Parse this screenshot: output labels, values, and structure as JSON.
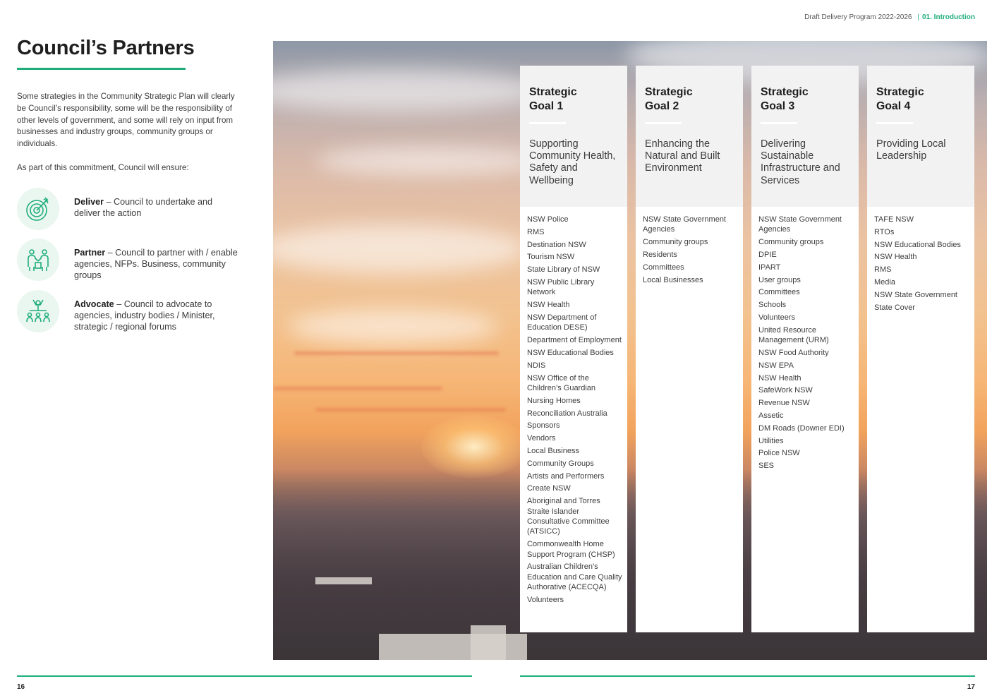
{
  "header": {
    "document": "Draft Delivery Program 2022-2026",
    "separator": "|",
    "section": "01. Introduction"
  },
  "title": "Council’s Partners",
  "intro": {
    "paragraph1": "Some strategies in the Community Strategic Plan will clearly be Council’s responsibility, some will be the responsibility of other levels of government, and some will rely on input from businesses and industry groups, community groups or individuals.",
    "paragraph2": "As part of this commitment, Council will ensure:"
  },
  "legend": [
    {
      "icon": "target-icon",
      "term": "Deliver",
      "description": " – Council to undertake and deliver the action"
    },
    {
      "icon": "partner-people-icon",
      "term": "Partner",
      "description": " – Council to partner with / enable agencies, NFPs. Business, community groups"
    },
    {
      "icon": "advocate-group-icon",
      "term": "Advocate",
      "description": " – Council to advocate to agencies, industry bodies / Minister, strategic / regional forums"
    }
  ],
  "goals": [
    {
      "label_line1": "Strategic",
      "label_line2": "Goal 1",
      "subtitle": "Supporting Community Health, Safety and Wellbeing",
      "partners": [
        "NSW Police",
        "RMS",
        "Destination NSW",
        "Tourism NSW",
        "State Library of NSW",
        "NSW Public Library Network",
        "NSW Health",
        "NSW Department of Education DESE)",
        "Department of Employment",
        "NSW Educational Bodies",
        "NDIS",
        "NSW Office of the Children’s Guardian",
        "Nursing Homes",
        "Reconciliation Australia",
        "Sponsors",
        "Vendors",
        "Local Business",
        "Community Groups",
        "Artists and Performers",
        "Create NSW",
        "Aboriginal and Torres Straite Islander Consultative Committee (ATSICC)",
        "Commonwealth Home Support Program (CHSP)",
        "Australian Children’s Education and Care Quality Authorative (ACECQA)",
        "Volunteers"
      ]
    },
    {
      "label_line1": "Strategic",
      "label_line2": "Goal 2",
      "subtitle": "Enhancing the Natural and Built Environment",
      "partners": [
        "NSW State Government Agencies",
        "Community groups",
        "Residents",
        "Committees",
        "Local Businesses"
      ]
    },
    {
      "label_line1": "Strategic",
      "label_line2": "Goal 3",
      "subtitle": "Delivering Sustainable Infrastructure and Services",
      "partners": [
        "NSW State Government Agencies",
        "Community groups",
        "DPIE",
        "IPART",
        "User groups",
        "Committees",
        "Schools",
        "Volunteers",
        "United Resource Management (URM)",
        "NSW Food Authority",
        "NSW EPA",
        "NSW Health",
        "SafeWork NSW",
        "Revenue NSW",
        "Assetic",
        "DM Roads (Downer EDI)",
        "Utilities",
        "Police NSW",
        "SES"
      ]
    },
    {
      "label_line1": "Strategic",
      "label_line2": "Goal 4",
      "subtitle": "Providing Local Leadership",
      "partners": [
        "TAFE NSW",
        "RTOs",
        "NSW Educational Bodies",
        "NSW Health",
        "RMS",
        "Media",
        "NSW State Government",
        "State Cover"
      ]
    }
  ],
  "footer": {
    "page_left": "16",
    "page_right": "17"
  },
  "colors": {
    "accent": "#1fae7a",
    "icon_bg": "#eaf6f0",
    "card_head": "#f1f2f1"
  }
}
